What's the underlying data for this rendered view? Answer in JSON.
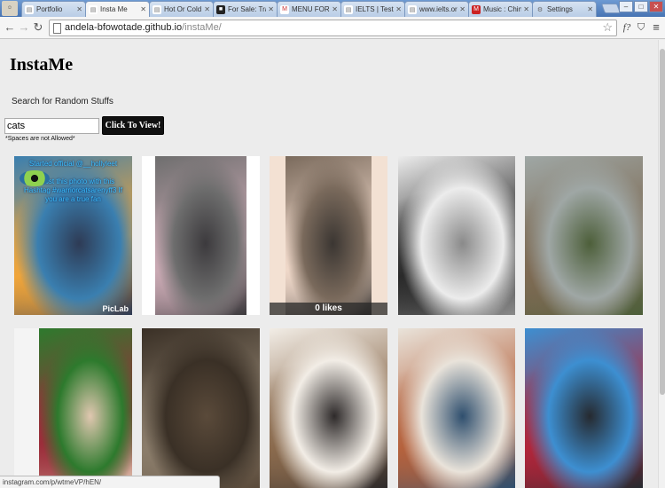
{
  "browser": {
    "tabs": [
      {
        "title": "Portfolio",
        "favicon": "document-icon",
        "active": false
      },
      {
        "title": "Insta Me",
        "favicon": "document-icon",
        "active": true
      },
      {
        "title": "Hot Or Cold",
        "favicon": "document-icon",
        "active": false
      },
      {
        "title": "For Sale: Tra",
        "favicon": "dark-square-icon",
        "active": false
      },
      {
        "title": "MENU FOR",
        "favicon": "gmail-icon",
        "active": false
      },
      {
        "title": "IELTS | Test",
        "favicon": "document-icon",
        "active": false
      },
      {
        "title": "www.ielts.org",
        "favicon": "document-icon",
        "active": false
      },
      {
        "title": "Music : Chin",
        "favicon": "red-square-icon",
        "active": false
      },
      {
        "title": "Settings",
        "favicon": "gear-icon",
        "active": false
      }
    ],
    "address": {
      "host": "andela-bfowotade.github.io",
      "path": "/instaMe/"
    },
    "status_url": "instagram.com/p/wtmeVP/hEN/"
  },
  "page": {
    "title": "InstaMe",
    "search_label": "Search for Random Stuffs",
    "search_value": "cats",
    "button_label": "Click To View!",
    "note": "*Spaces are not Allowed*"
  },
  "tiles": [
    {
      "name": "cat-repost-promo",
      "overlay_text": "Started official @__hollyleet\n\nRepost this photo with this Hashtag #warriorcatsarenyff3 If you are a true fan",
      "credit": "PicLab",
      "palette": [
        "#3a7fb0",
        "#f0a53a",
        "#2e3b55"
      ]
    },
    {
      "name": "two-grey-cats",
      "palette": [
        "#6e6e6e",
        "#c9a9b3",
        "#3c3a3d"
      ]
    },
    {
      "name": "cat-on-chair",
      "likes_label": "0 likes",
      "palette": [
        "#7a6a5c",
        "#efd8c9",
        "#3b3632"
      ]
    },
    {
      "name": "two-figures-bw",
      "palette": [
        "#ececec",
        "#2a2a2a",
        "#8a8a8a"
      ]
    },
    {
      "name": "cat-on-roof",
      "palette": [
        "#9fa7a5",
        "#7d6a53",
        "#4d5f3a"
      ]
    },
    {
      "name": "woman-with-kitten",
      "palette": [
        "#2d7a2d",
        "#9b2d3a",
        "#e0c7b0"
      ]
    },
    {
      "name": "tabby-cat-indoors",
      "palette": [
        "#3a3026",
        "#8b7d6b",
        "#5a4a3a"
      ]
    },
    {
      "name": "calico-cat-closeup",
      "palette": [
        "#f2ede6",
        "#8a6a4d",
        "#2e2a2a"
      ]
    },
    {
      "name": "girls-wrapping-gifts",
      "palette": [
        "#e9e3da",
        "#b5623d",
        "#2f4f6e"
      ]
    },
    {
      "name": "cat-with-plush-toy",
      "palette": [
        "#3d8fd1",
        "#b0263a",
        "#262a30"
      ]
    }
  ]
}
